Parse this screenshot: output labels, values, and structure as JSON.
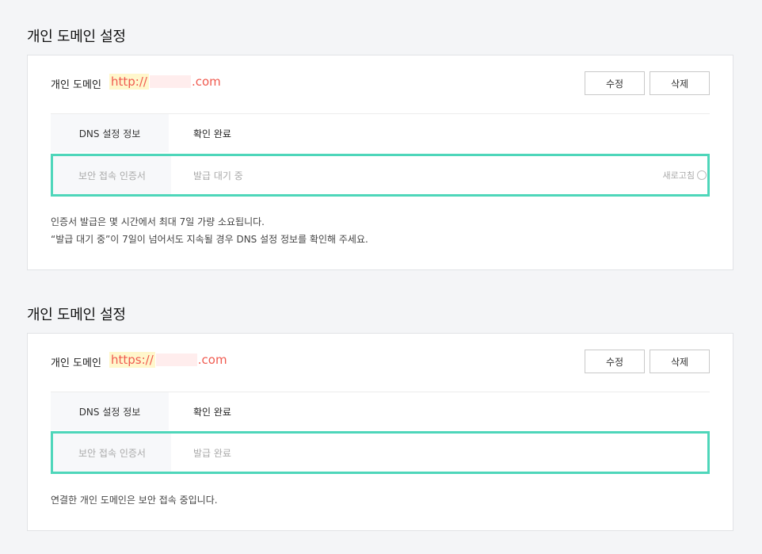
{
  "sections": [
    {
      "title": "개인 도메인 설정",
      "domain_label": "개인 도메인",
      "domain_prefix": "http://",
      "domain_suffix": ".com",
      "edit_label": "수정",
      "delete_label": "삭제",
      "dns_label": "DNS 설정 정보",
      "dns_status": "확인 완료",
      "cert_label": "보안 접속 인증서",
      "cert_status": "발급 대기 중",
      "refresh_label": "새로고침",
      "notes": [
        "인증서 발급은 몇 시간에서 최대 7일 가량 소요됩니다.",
        "“발급 대기 중”이 7일이 넘어서도 지속될 경우 DNS 설정 정보를 확인해 주세요."
      ]
    },
    {
      "title": "개인 도메인 설정",
      "domain_label": "개인 도메인",
      "domain_prefix": "https://",
      "domain_suffix": ".com",
      "edit_label": "수정",
      "delete_label": "삭제",
      "dns_label": "DNS 설정 정보",
      "dns_status": "확인 완료",
      "cert_label": "보안 접속 인증서",
      "cert_status": "발급 완료",
      "notes": [
        "연결한 개인 도메인은 보안 접속 중입니다."
      ]
    }
  ],
  "colors": {
    "domain_text": "#f05a4f",
    "highlight_border": "#4ed6ba",
    "page_bg": "#f4f5f7"
  },
  "icons": {
    "refresh": "refresh-icon"
  }
}
